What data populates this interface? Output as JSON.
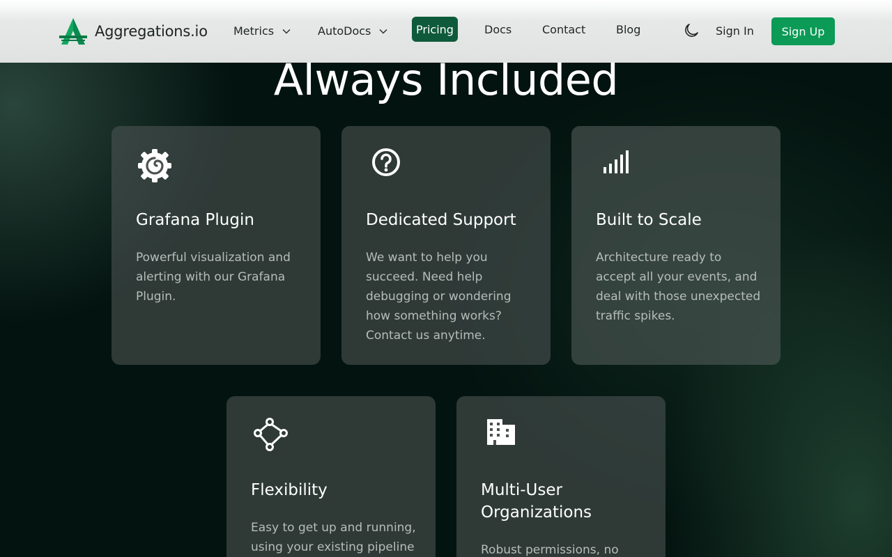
{
  "nav": {
    "brand": "Aggregations.io",
    "items": [
      {
        "label": "Metrics",
        "has_dropdown": true
      },
      {
        "label": "AutoDocs",
        "has_dropdown": true
      },
      {
        "label": "Pricing",
        "active": true
      },
      {
        "label": "Docs"
      },
      {
        "label": "Contact"
      },
      {
        "label": "Blog"
      }
    ],
    "theme_icon": "moon-icon",
    "sign_in": "Sign In",
    "sign_up": "Sign Up"
  },
  "section": {
    "title": "Always Included"
  },
  "cards": [
    {
      "icon": "grafana-icon",
      "title": "Grafana Plugin",
      "description": "Powerful visualization and alerting with our Grafana Plugin."
    },
    {
      "icon": "question-circle-icon",
      "title": "Dedicated Support",
      "description": "We want to help you succeed. Need help debugging or wondering how something works? Contact us anytime."
    },
    {
      "icon": "signal-bars-icon",
      "title": "Built to Scale",
      "description": "Architecture ready to accept all your events, and deal with those unexpected traffic spikes."
    },
    {
      "icon": "nodes-icon",
      "title": "Flexibility",
      "description": "Easy to get up and running, using your existing pipeline"
    },
    {
      "icon": "buildings-icon",
      "title": "Multi-User Organizations",
      "description": "Robust permissions, no"
    }
  ],
  "colors": {
    "brand_green": "#0c9a57",
    "pricing_active": "#0f5a3a",
    "background": "#03130f",
    "card": "#4a5250"
  }
}
